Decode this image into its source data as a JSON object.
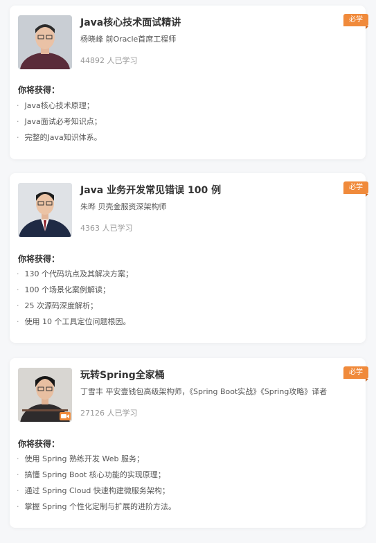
{
  "colors": {
    "accent": "#f08a3b",
    "card": "#ffffff",
    "background": "#f6f7f9"
  },
  "courses": [
    {
      "title": "Java核心技术面试精讲",
      "author": "杨晓峰 前Oracle首席工程师",
      "learners": "44892 人已学习",
      "badge": "必学",
      "gain_heading": "你将获得：",
      "gains": [
        "Java核心技术原理；",
        "Java面试必考知识点；",
        "完整的Java知识体系。"
      ]
    },
    {
      "title": "Java 业务开发常见错误 100 例",
      "author": "朱晔 贝壳金服资深架构师",
      "learners": "4363 人已学习",
      "badge": "必学",
      "gain_heading": "你将获得：",
      "gains": [
        "130 个代码坑点及其解决方案；",
        "100 个场景化案例解读；",
        "25 次源码深度解析；",
        "使用 10 个工具定位问题根因。"
      ]
    },
    {
      "title": "玩转Spring全家桶",
      "author": "丁雪丰 平安壹钱包高级架构师，《Spring Boot实战》《Spring攻略》译者",
      "learners": "27126 人已学习",
      "badge": "必学",
      "gain_heading": "你将获得：",
      "gains": [
        "使用 Spring 熟练开发 Web 服务；",
        "搞懂 Spring Boot 核心功能的实现原理；",
        "通过 Spring Cloud 快速构建微服务架构；",
        "掌握 Spring 个性化定制与扩展的进阶方法。"
      ]
    }
  ]
}
